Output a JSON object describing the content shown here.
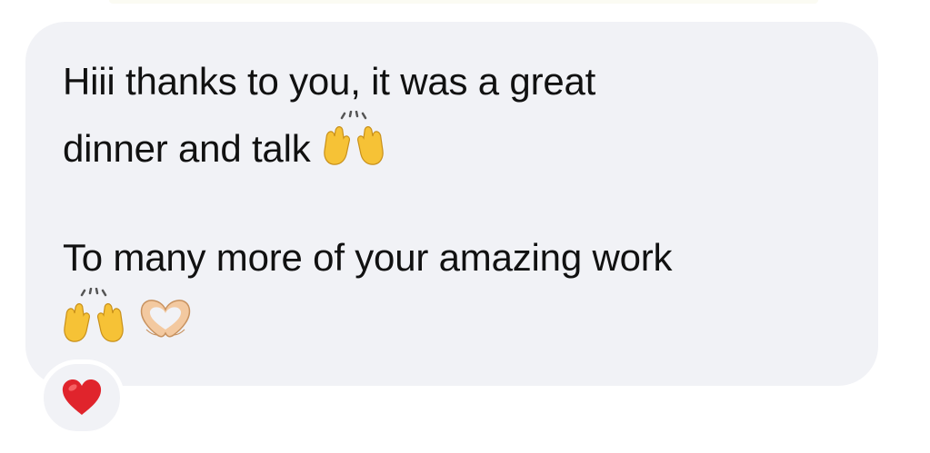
{
  "message": {
    "line1": "Hiii thanks to you, it was a great",
    "line2": "dinner and talk",
    "line2_emoji": "raising-hands",
    "line3": "To many more of your amazing work",
    "line4_emojis": [
      "raising-hands",
      "heart-hands"
    ]
  },
  "reaction": {
    "emoji": "red-heart"
  },
  "colors": {
    "bubble": "#f1f2f6",
    "text": "#111111",
    "heart": "#e0242c",
    "hands": "#f6c236"
  }
}
